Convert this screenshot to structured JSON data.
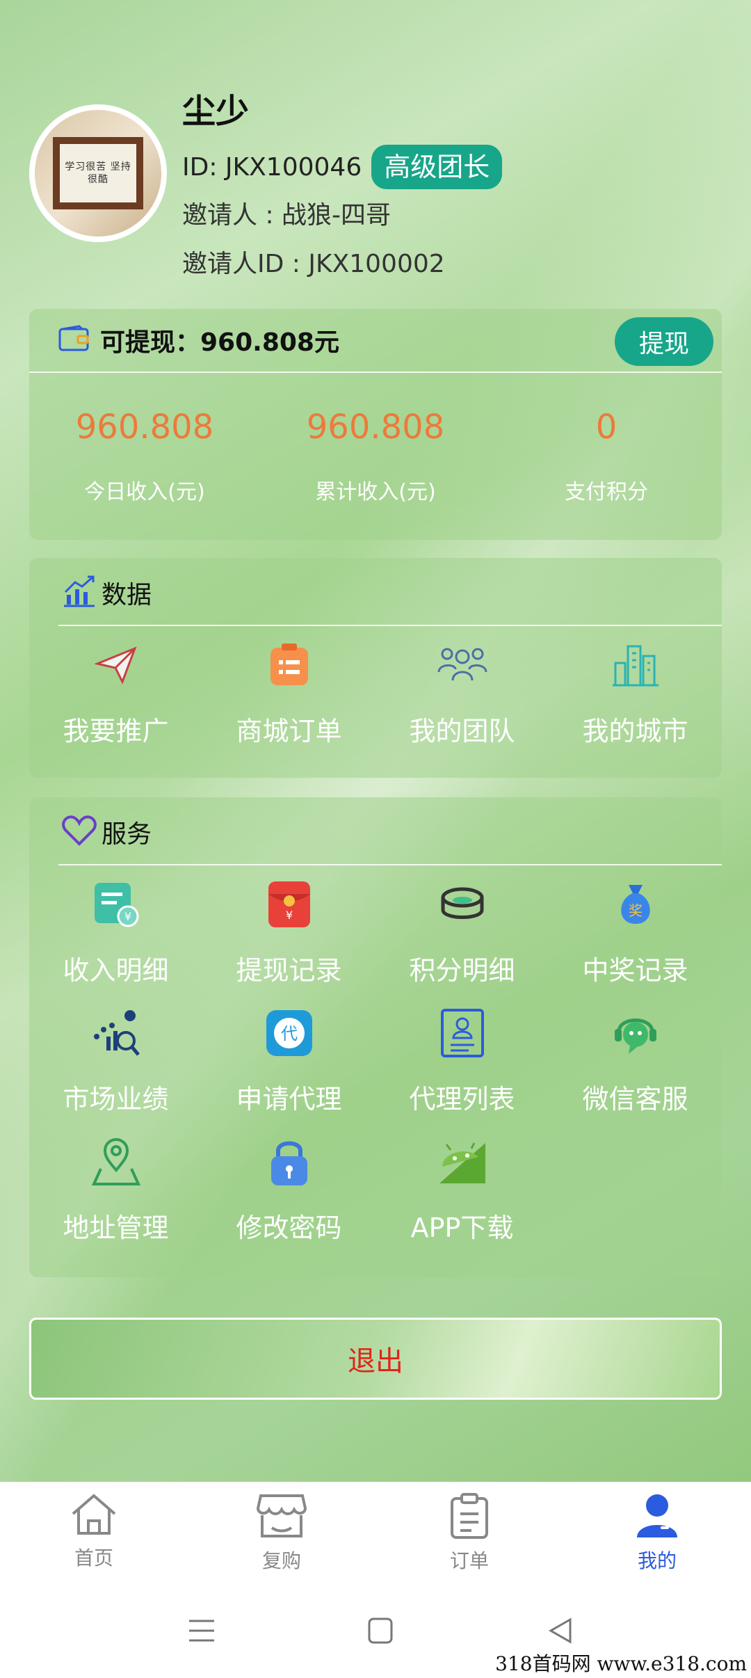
{
  "profile": {
    "name": "尘少",
    "id_label": "ID: JKX100046",
    "badge": "高级团长",
    "inviter": "邀请人 : 战狼-四哥",
    "inviter_id": "邀请人ID : JKX100002",
    "avatar_text": "学习很苦 坚持很酷"
  },
  "wallet": {
    "title": "可提现：960.808元",
    "withdraw_button": "提现",
    "stats": [
      {
        "value": "960.808",
        "label": "今日收入(元)"
      },
      {
        "value": "960.808",
        "label": "累计收入(元)"
      },
      {
        "value": "0",
        "label": "支付积分"
      }
    ]
  },
  "data_section": {
    "title": "数据",
    "items": [
      {
        "label": "我要推广",
        "icon": "paper-plane-icon"
      },
      {
        "label": "商城订单",
        "icon": "order-list-icon"
      },
      {
        "label": "我的团队",
        "icon": "team-icon"
      },
      {
        "label": "我的城市",
        "icon": "city-icon"
      }
    ]
  },
  "service_section": {
    "title": "服务",
    "items": [
      {
        "label": "收入明细",
        "icon": "income-doc-icon"
      },
      {
        "label": "提现记录",
        "icon": "red-envelope-icon"
      },
      {
        "label": "积分明细",
        "icon": "coins-icon"
      },
      {
        "label": "中奖记录",
        "icon": "prize-bag-icon"
      },
      {
        "label": "市场业绩",
        "icon": "market-chart-icon"
      },
      {
        "label": "申请代理",
        "icon": "agent-apply-icon"
      },
      {
        "label": "代理列表",
        "icon": "agent-list-icon"
      },
      {
        "label": "微信客服",
        "icon": "customer-service-icon"
      },
      {
        "label": "地址管理",
        "icon": "map-pin-icon"
      },
      {
        "label": "修改密码",
        "icon": "lock-icon"
      },
      {
        "label": "APP下载",
        "icon": "android-icon"
      }
    ]
  },
  "logout": "退出",
  "tabbar": [
    {
      "label": "首页",
      "icon": "home-icon",
      "active": false
    },
    {
      "label": "复购",
      "icon": "store-icon",
      "active": false
    },
    {
      "label": "订单",
      "icon": "clipboard-icon",
      "active": false
    },
    {
      "label": "我的",
      "icon": "user-icon",
      "active": true
    }
  ],
  "colors": {
    "accent": "#17a689",
    "stat_value": "#ec7a3c",
    "active_tab": "#2b5bde",
    "logout_text": "#e0241a"
  },
  "watermark": "318首码网 www.e318.com"
}
